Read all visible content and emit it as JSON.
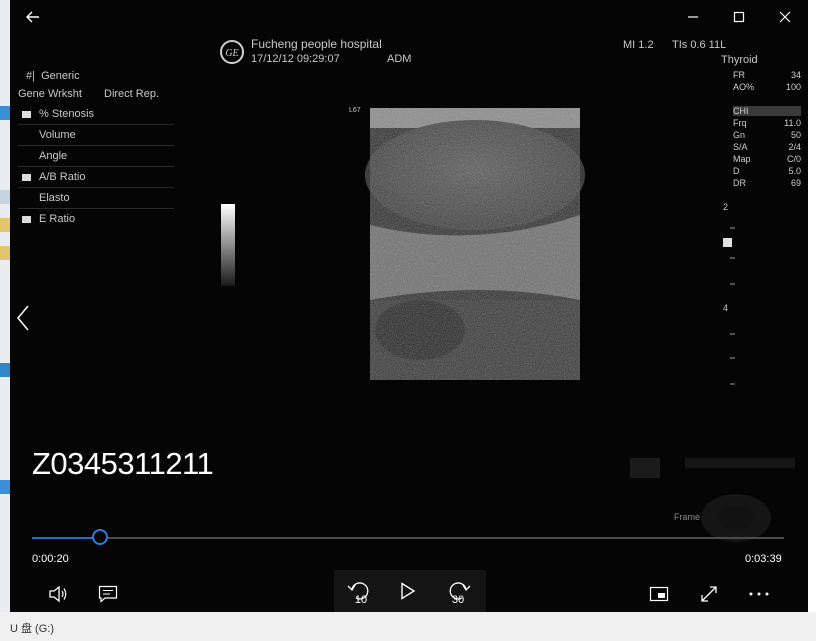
{
  "window": {
    "back_icon": "arrow-left-icon",
    "minimize_icon": "minimize-icon",
    "maximize_icon": "maximize-icon",
    "close_icon": "close-icon"
  },
  "ultrasound": {
    "hospital": "Fucheng people hospital",
    "datetime": "17/12/12 09:29:07",
    "operator": "ADM",
    "mi": "MI 1.2",
    "tis": "TIs 0.6 11L",
    "preset": "Thyroid",
    "probe_tag": "L67",
    "menu_header_left": "Gene Wrksht",
    "menu_header_right": "Direct Rep.",
    "menu_title": "Generic",
    "menu_items": [
      "% Stenosis",
      "Volume",
      "Angle",
      "A/B Ratio",
      "Elasto",
      "E Ratio"
    ],
    "params_top": [
      {
        "k": "FR",
        "v": "34"
      },
      {
        "k": "AO%",
        "v": "100"
      }
    ],
    "params_mode": "CHI",
    "params": [
      {
        "k": "Frq",
        "v": "11.0"
      },
      {
        "k": "Gn",
        "v": "50"
      },
      {
        "k": "S/A",
        "v": "2/4"
      },
      {
        "k": "Map",
        "v": "C/0"
      },
      {
        "k": "D",
        "v": "5.0"
      },
      {
        "k": "DR",
        "v": "69"
      }
    ],
    "depth_labels": [
      "2",
      "4"
    ],
    "ghost_frame": "Frame"
  },
  "player": {
    "file_id": "Z0345311211",
    "time_elapsed": "0:00:20",
    "time_total": "0:03:39",
    "progress": 0.091,
    "skip_back_seconds": "10",
    "skip_forward_seconds": "30",
    "icons": {
      "volume": "volume-icon",
      "captions": "captions-icon",
      "skip_back": "skip-back-10-icon",
      "play": "play-icon",
      "skip_forward": "skip-forward-30-icon",
      "mini_view": "mini-view-icon",
      "fullscreen": "fullscreen-icon",
      "more": "more-icon",
      "previous": "chevron-left-icon"
    }
  },
  "desktop": {
    "drive_label": "U 盘 (G:)"
  },
  "colors": {
    "player_bg": "#050505",
    "accent": "#2b7de0",
    "text": "#ffffff"
  }
}
